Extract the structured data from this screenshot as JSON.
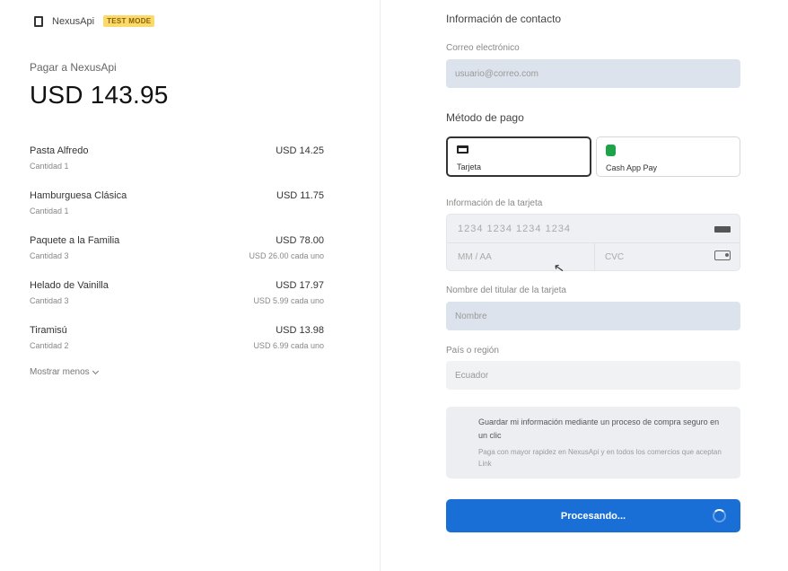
{
  "merchant": {
    "name": "NexusApi",
    "badge": "TEST MODE",
    "pay_to": "Pagar a NexusApi",
    "total": "USD 143.95"
  },
  "items": [
    {
      "name": "Pasta Alfredo",
      "qty": "Cantidad 1",
      "price": "USD 14.25",
      "unit": ""
    },
    {
      "name": "Hamburguesa Clásica",
      "qty": "Cantidad 1",
      "price": "USD 11.75",
      "unit": ""
    },
    {
      "name": "Paquete a la Familia",
      "qty": "Cantidad 3",
      "price": "USD 78.00",
      "unit": "USD 26.00 cada uno"
    },
    {
      "name": "Helado de Vainilla",
      "qty": "Cantidad 3",
      "price": "USD 17.97",
      "unit": "USD 5.99 cada uno"
    },
    {
      "name": "Tiramisú",
      "qty": "Cantidad 2",
      "price": "USD 13.98",
      "unit": "USD 6.99 cada uno"
    }
  ],
  "show_more": "Mostrar menos",
  "form": {
    "contact_heading": "Información de contacto",
    "email_label": "Correo electrónico",
    "email_value": "usuario@correo.com",
    "payment_heading": "Método de pago",
    "methods": [
      {
        "label": "Tarjeta",
        "icon": "card-icon"
      },
      {
        "label": "Cash App Pay",
        "icon": "cash-app-icon"
      }
    ],
    "card_label": "Información de la tarjeta",
    "card_number": "1234 1234 1234 1234",
    "card_expiry": "MM / AA",
    "card_cvc": "CVC",
    "name_label": "Nombre del titular de la tarjeta",
    "name_value": "Nombre",
    "country_label": "País o región",
    "country_value": "Ecuador",
    "save_title": "Guardar mi información mediante un proceso de compra seguro en un clic",
    "save_desc": "Paga con mayor rapidez en NexusApi y en todos los comercios que aceptan Link",
    "submit": "Procesando..."
  }
}
